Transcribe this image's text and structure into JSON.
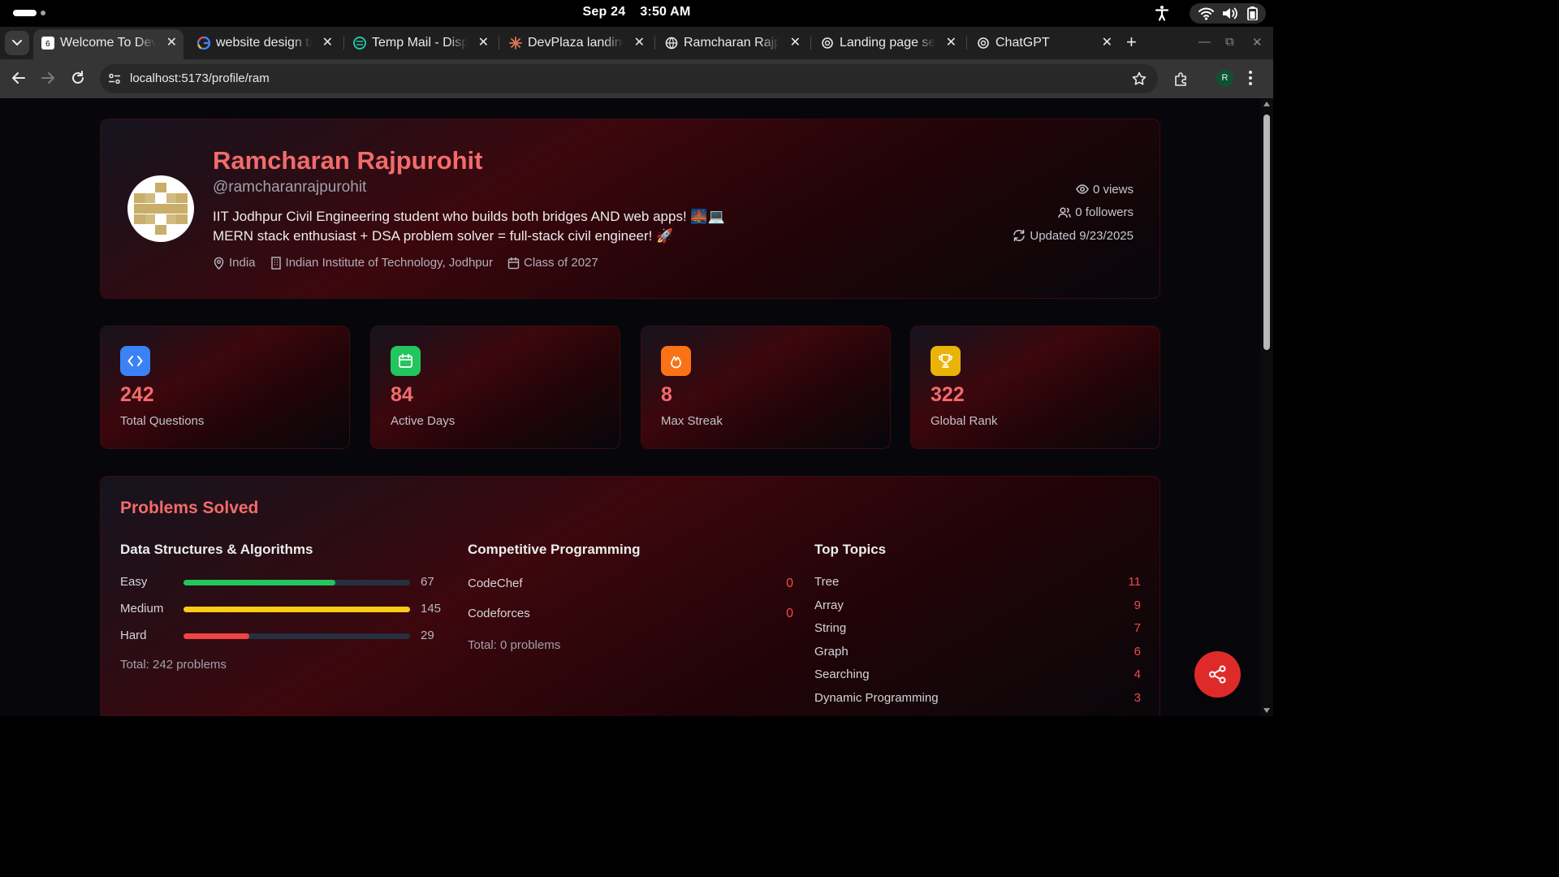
{
  "os": {
    "date": "Sep 24",
    "time": "3:50 AM"
  },
  "browser": {
    "tabs": [
      {
        "title": "Welcome To DevPlaza",
        "icon": "devplaza-favicon-icon",
        "active": true
      },
      {
        "title": "website design tips",
        "icon": "google-icon"
      },
      {
        "title": "Temp Mail - Disposable",
        "icon": "tempmail-icon"
      },
      {
        "title": "DevPlaza landing page",
        "icon": "claude-icon"
      },
      {
        "title": "Ramcharan Rajpurohit",
        "icon": "github-icon"
      },
      {
        "title": "Landing page sections",
        "icon": "chatgpt-icon"
      },
      {
        "title": "ChatGPT",
        "icon": "chatgpt-icon"
      }
    ],
    "url": "localhost:5173/profile/ram",
    "profile_initial": "R"
  },
  "profile": {
    "name": "Ramcharan Rajpurohit",
    "handle": "@ramcharanrajpurohit",
    "bio_line1": "IIT Jodhpur Civil Engineering student who builds both bridges AND web apps! 🌉💻",
    "bio_line2": "MERN stack enthusiast + DSA problem solver = full-stack civil engineer! 🚀",
    "location": "India",
    "institute": "Indian Institute of Technology, Jodhpur",
    "class_of": "Class of 2027",
    "views": "0 views",
    "followers": "0 followers",
    "updated": "Updated 9/23/2025"
  },
  "stats": [
    {
      "value": "242",
      "label": "Total Questions",
      "icon": "code-icon",
      "color": "#3b82f6"
    },
    {
      "value": "84",
      "label": "Active Days",
      "icon": "calendar-icon",
      "color": "#22c55e"
    },
    {
      "value": "8",
      "label": "Max Streak",
      "icon": "flame-icon",
      "color": "#f97316"
    },
    {
      "value": "322",
      "label": "Global Rank",
      "icon": "trophy-icon",
      "color": "#eab308"
    }
  ],
  "problems": {
    "title": "Problems Solved",
    "dsa": {
      "title": "Data Structures & Algorithms",
      "rows": [
        {
          "label": "Easy",
          "value": "67",
          "fraction": 0.67,
          "color": "#22c55e"
        },
        {
          "label": "Medium",
          "value": "145",
          "fraction": 1.0,
          "color": "#facc15"
        },
        {
          "label": "Hard",
          "value": "29",
          "fraction": 0.29,
          "color": "#ef4444"
        }
      ],
      "total": "Total: 242 problems"
    },
    "cp": {
      "title": "Competitive Programming",
      "rows": [
        {
          "label": "CodeChef",
          "value": "0"
        },
        {
          "label": "Codeforces",
          "value": "0"
        }
      ],
      "total": "Total: 0 problems"
    },
    "topics": {
      "title": "Top Topics",
      "rows": [
        {
          "label": "Tree",
          "value": "11"
        },
        {
          "label": "Array",
          "value": "9"
        },
        {
          "label": "String",
          "value": "7"
        },
        {
          "label": "Graph",
          "value": "6"
        },
        {
          "label": "Searching",
          "value": "4"
        },
        {
          "label": "Dynamic Programming",
          "value": "3"
        }
      ]
    }
  }
}
